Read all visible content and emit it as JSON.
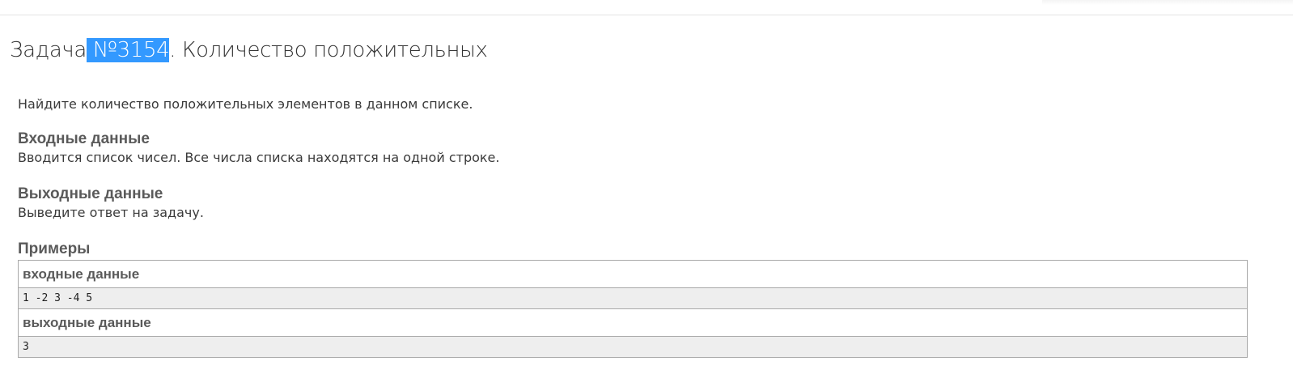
{
  "title": {
    "prefix": "Задача",
    "number": " №3154",
    "suffix": ". Количество положительных"
  },
  "statement": "Найдите количество положительных элементов в данном списке.",
  "input_section": {
    "heading": "Входные данные",
    "text": "Вводится список чисел. Все числа списка находятся на одной строке."
  },
  "output_section": {
    "heading": "Выходные данные",
    "text": "Выведите ответ на задачу."
  },
  "examples": {
    "heading": "Примеры",
    "input_label": "входные данные",
    "input_value": "1 -2 3 -4 5",
    "output_label": "выходные данные",
    "output_value": "3"
  },
  "colors": {
    "selection": "#3399ff",
    "sample_background": "#eeeeee",
    "border": "#a9a9a9"
  }
}
